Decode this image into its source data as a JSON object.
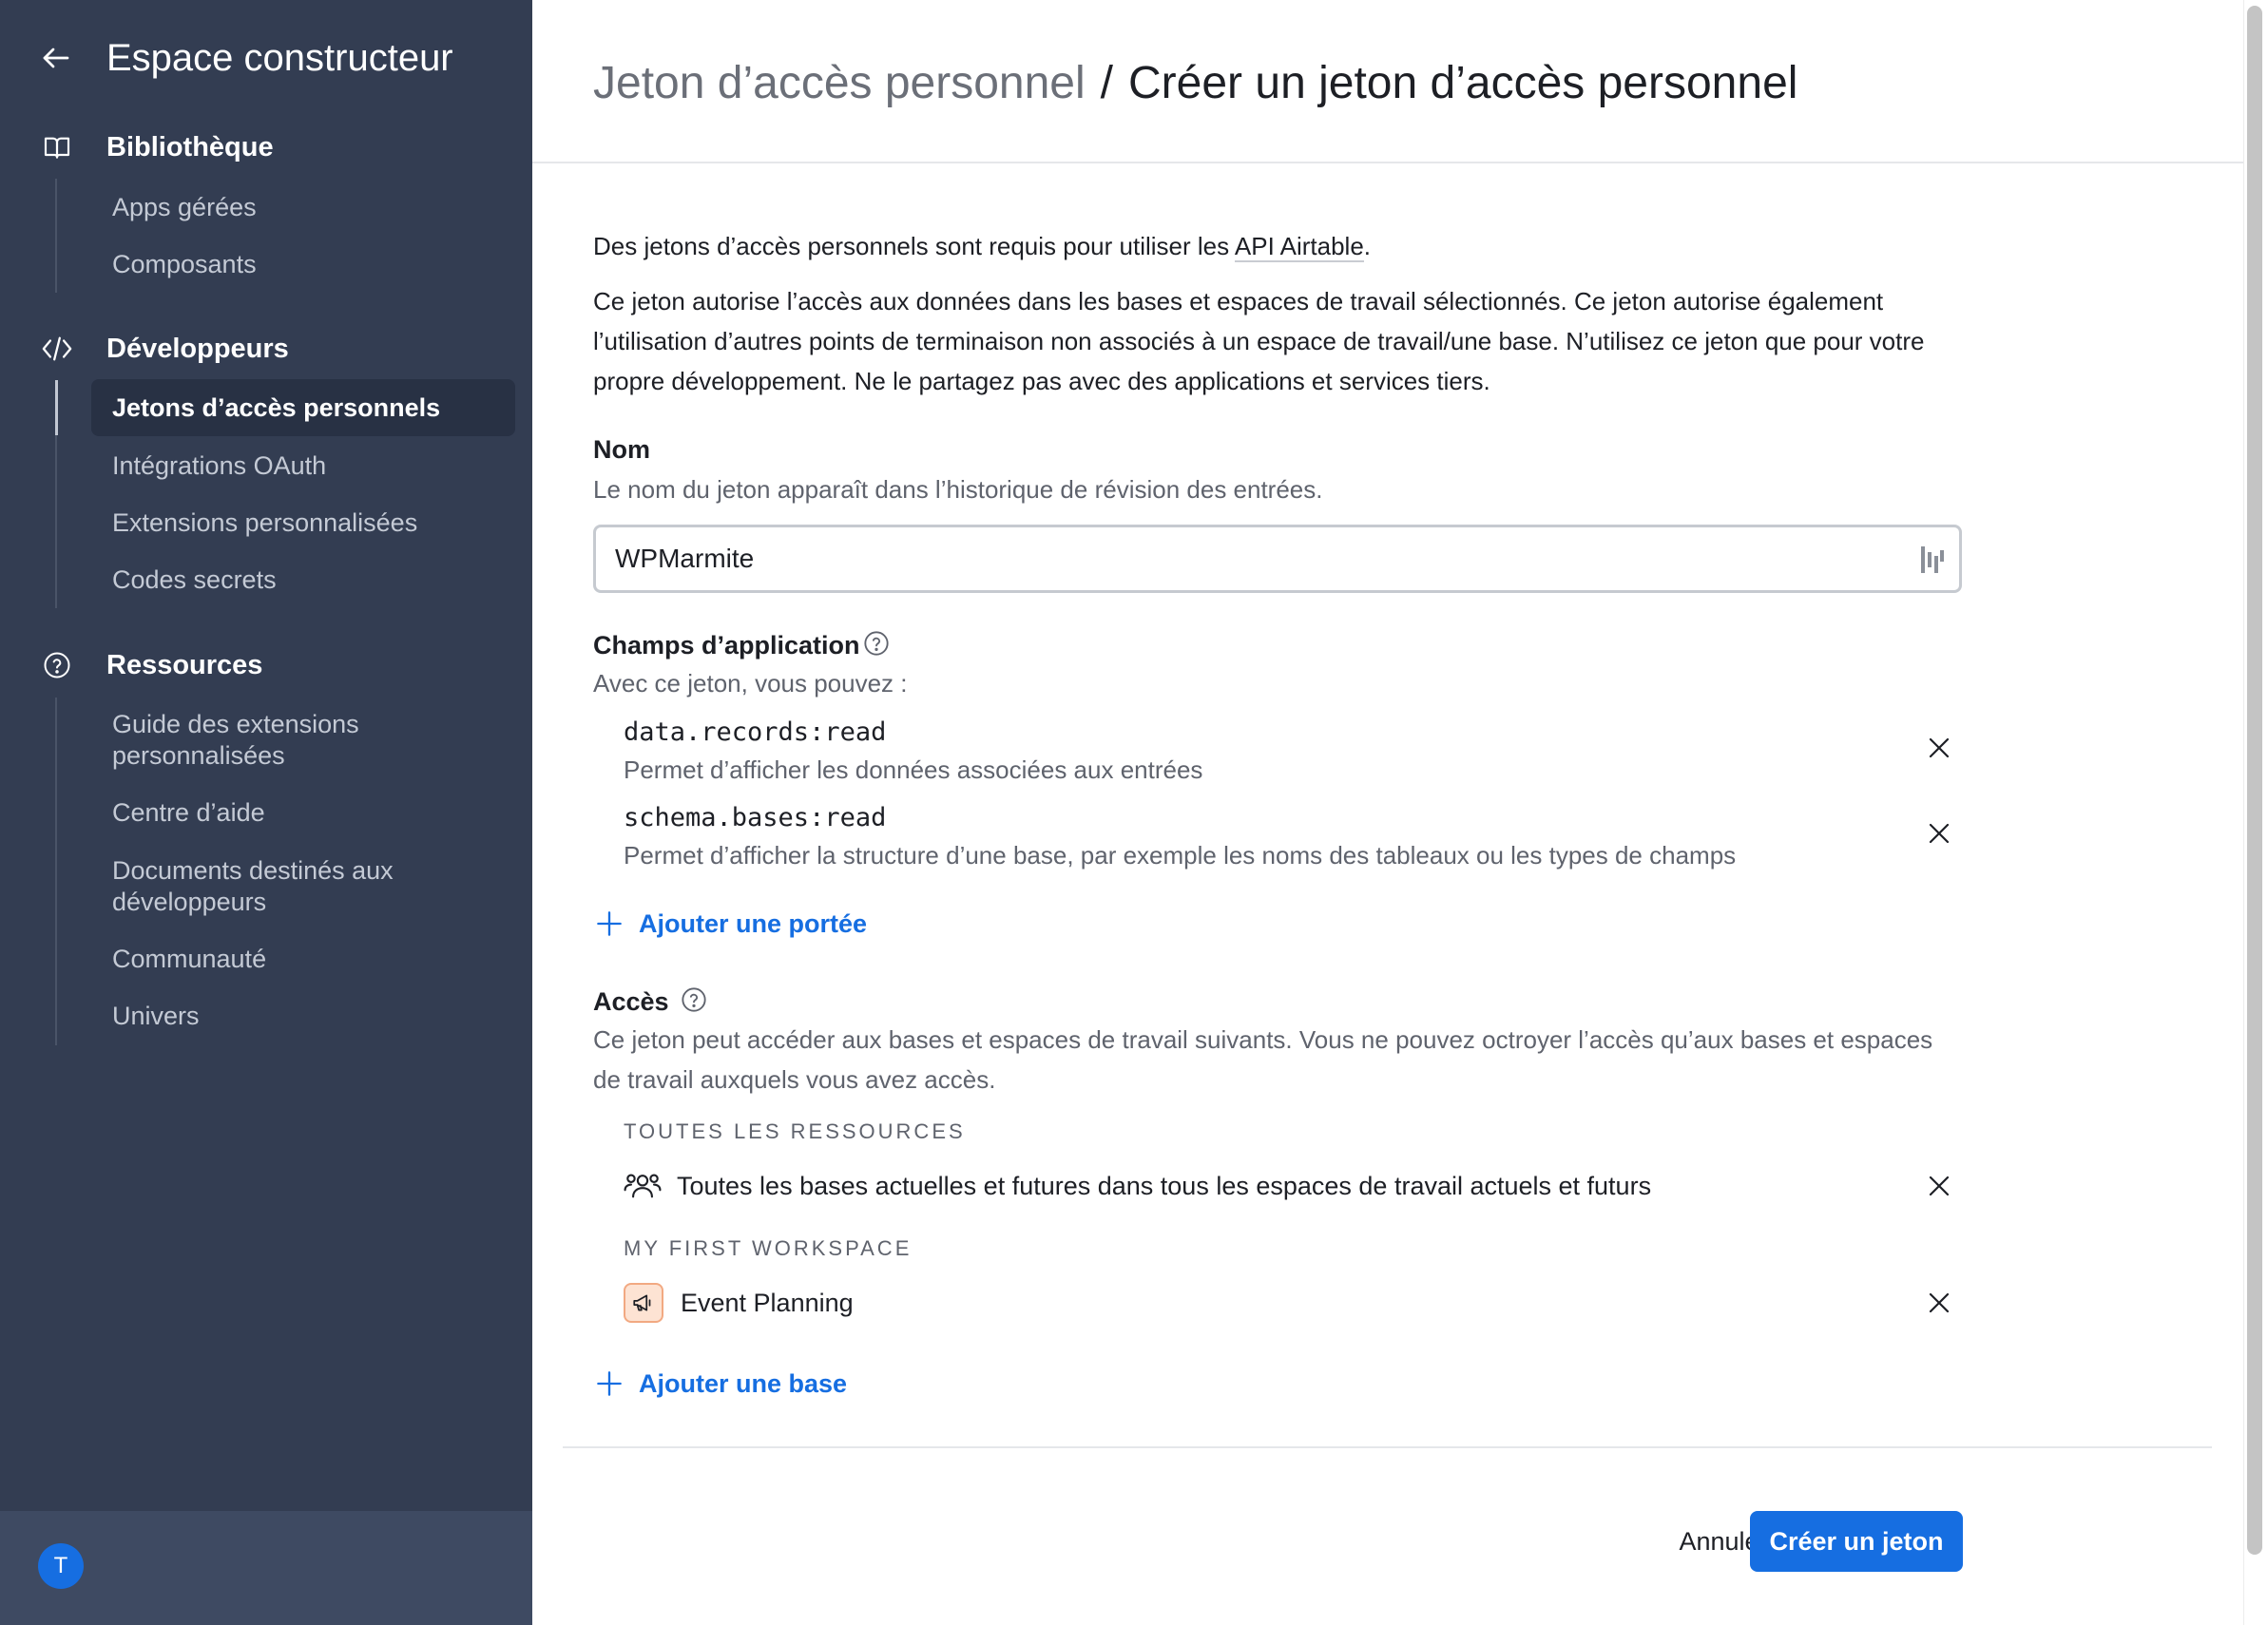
{
  "sidebar": {
    "title": "Espace constructeur",
    "sections": [
      {
        "label": "Bibliothèque",
        "icon": "book-icon",
        "items": [
          "Apps gérées",
          "Composants"
        ]
      },
      {
        "label": "Développeurs",
        "icon": "code-icon",
        "items": [
          "Jetons d’accès personnels",
          "Intégrations OAuth",
          "Extensions personnalisées",
          "Codes secrets"
        ]
      },
      {
        "label": "Ressources",
        "icon": "help-circle-icon",
        "items": [
          "Guide des extensions personnalisées",
          "Centre d’aide",
          "Documents destinés aux développeurs",
          "Communauté",
          "Univers"
        ]
      }
    ],
    "active_item": "Jetons d’accès personnels",
    "avatar_initial": "T"
  },
  "header": {
    "breadcrumb_parent": "Jeton d’accès personnel",
    "separator": "/",
    "breadcrumb_current": "Créer un jeton d’accès personnel"
  },
  "intro": {
    "line1_prefix": "Des jetons d’accès personnels sont requis pour utiliser les ",
    "line1_link": "API Airtable",
    "line1_suffix": ".",
    "paragraph": "Ce jeton autorise l’accès aux données dans les bases et espaces de travail sélectionnés. Ce jeton autorise également l’utilisation d’autres points de terminaison non associés à un espace de travail/une base. N’utilisez ce jeton que pour votre propre développement. Ne le partagez pas avec des applications et services tiers."
  },
  "name_field": {
    "label": "Nom",
    "help": "Le nom du jeton apparaît dans l’historique de révision des entrées.",
    "value": "WPMarmite"
  },
  "scopes": {
    "label": "Champs d’application",
    "help": "Avec ce jeton, vous pouvez :",
    "items": [
      {
        "name": "data.records:read",
        "description": "Permet d’afficher les données associées aux entrées"
      },
      {
        "name": "schema.bases:read",
        "description": "Permet d’afficher la structure d’une base, par exemple les noms des tableaux ou les types de champs"
      }
    ],
    "add_label": "Ajouter une portée"
  },
  "access": {
    "label": "Accès",
    "help": "Ce jeton peut accéder aux bases et espaces de travail suivants. Vous ne pouvez octroyer l’accès qu’aux bases et espaces de travail auxquels vous avez accès.",
    "groups": [
      {
        "heading": "TOUTES LES RESSOURCES",
        "item": "Toutes les bases actuelles et futures dans tous les espaces de travail actuels et futurs"
      },
      {
        "heading": "MY FIRST WORKSPACE",
        "item": "Event Planning"
      }
    ],
    "add_label": "Ajouter une base"
  },
  "actions": {
    "cancel": "Annuler",
    "create": "Créer un jeton"
  },
  "colors": {
    "sidebar_bg": "#333d52",
    "primary": "#166ee1",
    "base_icon_bg": "#fde3d3"
  }
}
